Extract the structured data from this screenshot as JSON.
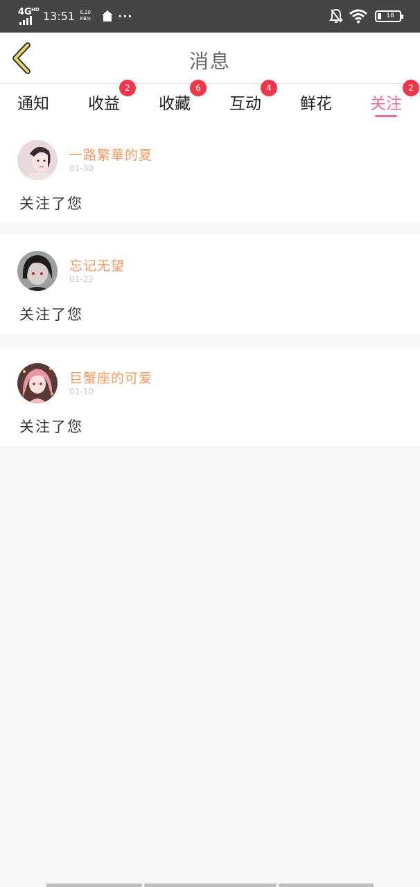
{
  "status_bar": {
    "network": "4G",
    "network_sub": "HD",
    "time": "13:51",
    "speed_value": "6.20",
    "speed_unit": "KB/s",
    "more": "···",
    "battery": "18"
  },
  "header": {
    "title": "消息"
  },
  "tabs": [
    {
      "label": "通知",
      "badge": ""
    },
    {
      "label": "收益",
      "badge": "2"
    },
    {
      "label": "收藏",
      "badge": "6"
    },
    {
      "label": "互动",
      "badge": "4"
    },
    {
      "label": "鲜花",
      "badge": ""
    },
    {
      "label": "关注",
      "badge": "2"
    }
  ],
  "active_tab": "关注",
  "messages": [
    {
      "user": "一路繁華的夏",
      "time": "01-30",
      "text": "关注了您"
    },
    {
      "user": "忘记无望",
      "time": "01-22",
      "text": "关注了您"
    },
    {
      "user": "巨蟹座的可爱",
      "time": "01-10",
      "text": "关注了您"
    }
  ],
  "colors": {
    "accent": "#e56f9a",
    "username": "#f09a62",
    "badge": "#f0364a",
    "back_arrow": "#e8d66a"
  }
}
